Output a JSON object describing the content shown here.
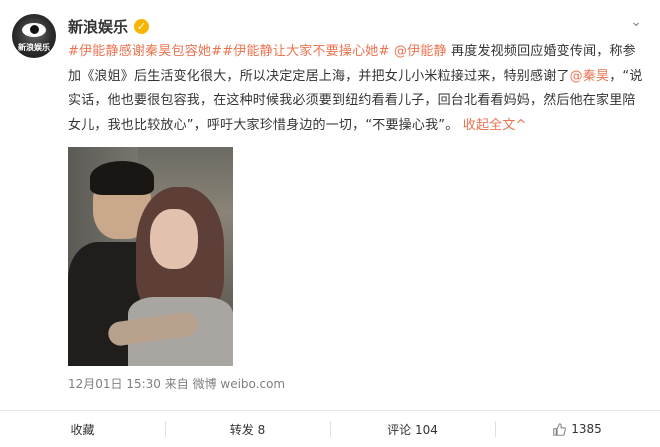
{
  "header": {
    "username": "新浪娱乐",
    "verified_mark": "✓",
    "avatar_text": "新浪娱乐",
    "more_icon": "chevron-down-icon"
  },
  "post": {
    "tag1": "#伊能静感谢秦昊包容她#",
    "tag2": "#伊能静让大家不要操心她#",
    "mention1": "@伊能静",
    "text1": " 再度发视频回应婚变传闻，称参加《浪姐》后生活变化很大，所以决定定居上海，并把女儿小米粒接过来，特别感谢了",
    "mention2": "@秦昊",
    "text2": "，“说实话，他也要很包容我，在这种时候我必须要到纽约看看儿子，回台北看看妈妈，然后他在家里陪女儿，我也比较放心”，呼吁大家珍惜身边的一切，“不要操心我”。",
    "fold_label": "收起全文^"
  },
  "meta": {
    "time": "12月01日 15:30",
    "source": "来自 微博 weibo.com"
  },
  "actions": {
    "collect": "收藏",
    "repost": "转发 8",
    "comment": "评论 104",
    "like": "1385"
  },
  "colors": {
    "link": "#eb7350",
    "verified": "#f7b500"
  }
}
